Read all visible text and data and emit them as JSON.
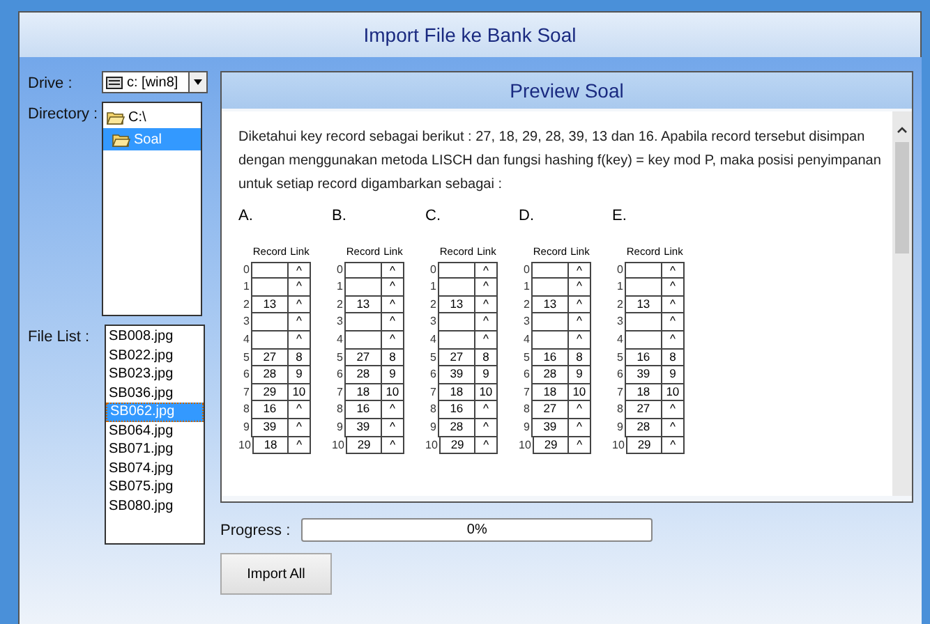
{
  "window": {
    "title": "Import File ke Bank Soal"
  },
  "drive": {
    "label": "Drive :",
    "value": "c: [win8]"
  },
  "directory": {
    "label": "Directory :",
    "items": [
      {
        "name": "C:\\",
        "selected": false
      },
      {
        "name": "Soal",
        "selected": true
      }
    ]
  },
  "file_list": {
    "label": "File List :",
    "items": [
      {
        "name": "SB008.jpg",
        "selected": false
      },
      {
        "name": "SB022.jpg",
        "selected": false
      },
      {
        "name": "SB023.jpg",
        "selected": false
      },
      {
        "name": "SB036.jpg",
        "selected": false
      },
      {
        "name": "SB062.jpg",
        "selected": true
      },
      {
        "name": "SB064.jpg",
        "selected": false
      },
      {
        "name": "SB071.jpg",
        "selected": false
      },
      {
        "name": "SB074.jpg",
        "selected": false
      },
      {
        "name": "SB075.jpg",
        "selected": false
      },
      {
        "name": "SB080.jpg",
        "selected": false
      }
    ]
  },
  "preview": {
    "title": "Preview Soal",
    "question": "Diketahui key record sebagai berikut : 27, 18, 29, 28, 39, 13 dan 16. Apabila record tersebut disimpan dengan menggunakan metoda LISCH dan fungsi hashing f(key) = key mod P, maka posisi penyimpanan untuk setiap record digambarkan sebagai :",
    "options": [
      {
        "letter": "A.",
        "headers": [
          "Record",
          "Link"
        ],
        "rows": [
          {
            "index": "0",
            "link": "^"
          },
          {
            "index": "1",
            "link": "^"
          },
          {
            "index": "2",
            "record": "13",
            "link": "^"
          },
          {
            "index": "3",
            "link": "^"
          },
          {
            "index": "4",
            "link": "^"
          },
          {
            "index": "5",
            "record": "27",
            "link": "8"
          },
          {
            "index": "6",
            "record": "28",
            "link": "9"
          },
          {
            "index": "7",
            "record": "29",
            "link": "10"
          },
          {
            "index": "8",
            "record": "16",
            "link": "^"
          },
          {
            "index": "9",
            "record": "39",
            "link": "^"
          },
          {
            "index": "10",
            "record": "18",
            "link": "^"
          }
        ]
      },
      {
        "letter": "B.",
        "headers": [
          "Record",
          "Link"
        ],
        "rows": [
          {
            "index": "0",
            "link": "^"
          },
          {
            "index": "1",
            "link": "^"
          },
          {
            "index": "2",
            "record": "13",
            "link": "^"
          },
          {
            "index": "3",
            "link": "^"
          },
          {
            "index": "4",
            "link": "^"
          },
          {
            "index": "5",
            "record": "27",
            "link": "8"
          },
          {
            "index": "6",
            "record": "28",
            "link": "9"
          },
          {
            "index": "7",
            "record": "18",
            "link": "10"
          },
          {
            "index": "8",
            "record": "16",
            "link": "^"
          },
          {
            "index": "9",
            "record": "39",
            "link": "^"
          },
          {
            "index": "10",
            "record": "29",
            "link": "^"
          }
        ]
      },
      {
        "letter": "C.",
        "headers": [
          "Record",
          "Link"
        ],
        "rows": [
          {
            "index": "0",
            "link": "^"
          },
          {
            "index": "1",
            "link": "^"
          },
          {
            "index": "2",
            "record": "13",
            "link": "^"
          },
          {
            "index": "3",
            "link": "^"
          },
          {
            "index": "4",
            "link": "^"
          },
          {
            "index": "5",
            "record": "27",
            "link": "8"
          },
          {
            "index": "6",
            "record": "39",
            "link": "9"
          },
          {
            "index": "7",
            "record": "18",
            "link": "10"
          },
          {
            "index": "8",
            "record": "16",
            "link": "^"
          },
          {
            "index": "9",
            "record": "28",
            "link": "^"
          },
          {
            "index": "10",
            "record": "29",
            "link": "^"
          }
        ]
      },
      {
        "letter": "D.",
        "headers": [
          "Record",
          "Link"
        ],
        "rows": [
          {
            "index": "0",
            "link": "^"
          },
          {
            "index": "1",
            "link": "^"
          },
          {
            "index": "2",
            "record": "13",
            "link": "^"
          },
          {
            "index": "3",
            "link": "^"
          },
          {
            "index": "4",
            "link": "^"
          },
          {
            "index": "5",
            "record": "16",
            "link": "8"
          },
          {
            "index": "6",
            "record": "28",
            "link": "9"
          },
          {
            "index": "7",
            "record": "18",
            "link": "10"
          },
          {
            "index": "8",
            "record": "27",
            "link": "^"
          },
          {
            "index": "9",
            "record": "39",
            "link": "^"
          },
          {
            "index": "10",
            "record": "29",
            "link": "^"
          }
        ]
      },
      {
        "letter": "E.",
        "headers": [
          "Record",
          "Link"
        ],
        "rows": [
          {
            "index": "0",
            "link": "^"
          },
          {
            "index": "1",
            "link": "^"
          },
          {
            "index": "2",
            "record": "13",
            "link": "^"
          },
          {
            "index": "3",
            "link": "^"
          },
          {
            "index": "4",
            "link": "^"
          },
          {
            "index": "5",
            "record": "16",
            "link": "8"
          },
          {
            "index": "6",
            "record": "39",
            "link": "9"
          },
          {
            "index": "7",
            "record": "18",
            "link": "10"
          },
          {
            "index": "8",
            "record": "27",
            "link": "^"
          },
          {
            "index": "9",
            "record": "28",
            "link": "^"
          },
          {
            "index": "10",
            "record": "29",
            "link": "^"
          }
        ]
      }
    ]
  },
  "progress": {
    "label": "Progress :",
    "level": 0,
    "reading": "0%"
  },
  "buttons": [
    "Import All"
  ]
}
